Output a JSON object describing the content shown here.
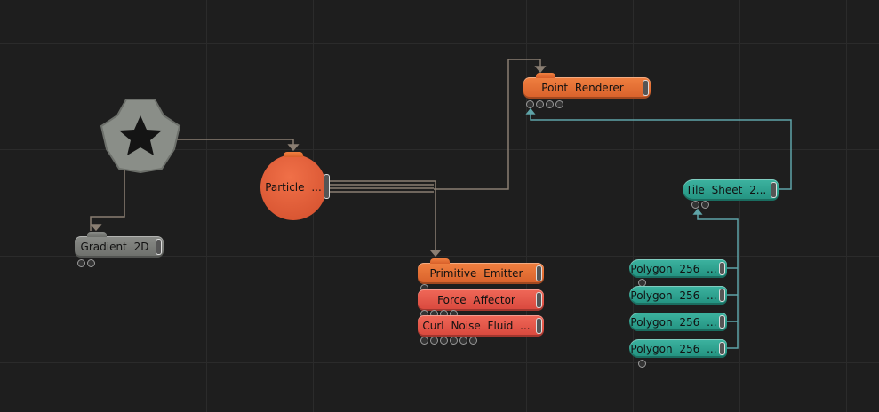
{
  "colors": {
    "background": "#1e1e1e",
    "wire": "#8a7e72",
    "wire_teal": "#5fa4a8",
    "orange": "#e8702f",
    "red": "#e35a4a",
    "teal": "#2fa391",
    "gray": "#7c7e7a"
  },
  "nodes": {
    "root": {
      "icon": "star-gear-icon"
    },
    "particle": {
      "label": "Particle ..."
    },
    "gradient": {
      "label": "Gradient 2D",
      "sockets": 2
    },
    "point_renderer": {
      "label": "Point Renderer",
      "sockets": 4
    },
    "primitive_emitter": {
      "label": "Primitive Emitter",
      "sockets": 1
    },
    "force_affector": {
      "label": "Force Affector",
      "sockets": 4
    },
    "curl_noise": {
      "label": "Curl Noise Fluid ...",
      "sockets": 6
    },
    "tile_sheet": {
      "label": "Tile Sheet 2...",
      "sockets": 2
    },
    "polygons": [
      {
        "label": "Polygon 256 ..."
      },
      {
        "label": "Polygon 256 ..."
      },
      {
        "label": "Polygon 256 ..."
      },
      {
        "label": "Polygon 256 ..."
      }
    ]
  }
}
